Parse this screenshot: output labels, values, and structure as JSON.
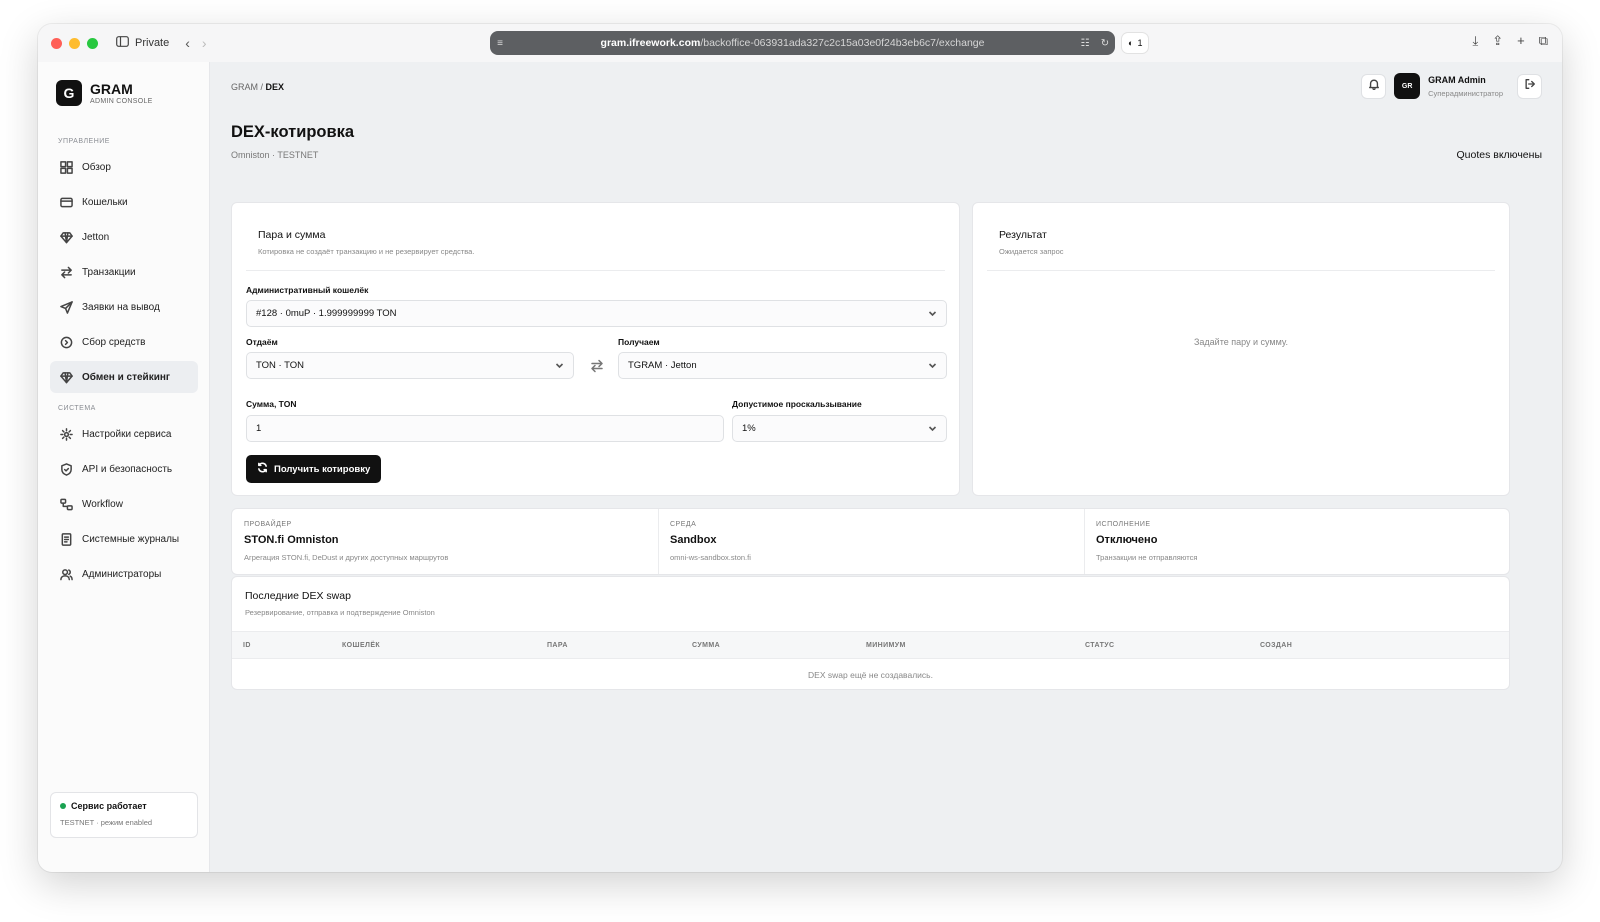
{
  "browser": {
    "private_label": "Private",
    "url_host": "gram.ifreework.com",
    "url_path": "/backoffice-063931ada327c2c15a03e0f24b3eb6c7/exchange",
    "badge_count": "1"
  },
  "brand": {
    "mark": "G",
    "title": "GRAM",
    "subtitle": "ADMIN CONSOLE"
  },
  "sidebar": {
    "section_manage": "УПРАВЛЕНИЕ",
    "section_system": "СИСТЕМА",
    "items": [
      {
        "label": "Обзор",
        "icon": "grid-icon"
      },
      {
        "label": "Кошельки",
        "icon": "wallet-icon"
      },
      {
        "label": "Jetton",
        "icon": "diamond-icon"
      },
      {
        "label": "Транзакции",
        "icon": "arrows-icon"
      },
      {
        "label": "Заявки на вывод",
        "icon": "send-icon"
      },
      {
        "label": "Сбор средств",
        "icon": "circle-icon"
      },
      {
        "label": "Обмен и стейкинг",
        "icon": "diamond-icon"
      }
    ],
    "system_items": [
      {
        "label": "Настройки сервиса",
        "icon": "gear-icon"
      },
      {
        "label": "API и безопасность",
        "icon": "shield-icon"
      },
      {
        "label": "Workflow",
        "icon": "workflow-icon"
      },
      {
        "label": "Системные журналы",
        "icon": "log-icon"
      },
      {
        "label": "Администраторы",
        "icon": "users-icon"
      }
    ],
    "status": {
      "title": "Сервис работает",
      "subtitle": "TESTNET · режим enabled",
      "color": "#1aa251"
    }
  },
  "header": {
    "breadcrumb_root": "GRAM",
    "breadcrumb_sep": " / ",
    "breadcrumb_current": "DEX",
    "avatar": "GR",
    "admin_name": "GRAM Admin",
    "admin_role": "Суперадминистратор"
  },
  "page": {
    "title": "DEX-котировка",
    "subtitle": "Omniston · TESTNET",
    "quotes_status": "Quotes включены"
  },
  "form": {
    "title": "Пара и сумма",
    "desc": "Котировка не создаёт транзакцию и не резервирует средства.",
    "wallet_label": "Административный кошелёк",
    "wallet_value": "#128 · 0muP · 1.999999999 TON",
    "give_label": "Отдаём",
    "give_value": "TON · TON",
    "get_label": "Получаем",
    "get_value": "TGRAM · Jetton",
    "amount_label": "Сумма, TON",
    "amount_value": "1",
    "slippage_label": "Допустимое проскальзывание",
    "slippage_value": "1%",
    "submit_label": "Получить котировку"
  },
  "result": {
    "title": "Результат",
    "desc": "Ожидается запрос",
    "empty": "Задайте пару и сумму."
  },
  "stats": [
    {
      "label": "ПРОВАЙДЕР",
      "value": "STON.fi Omniston",
      "desc": "Агрегация STON.fi, DeDust и других доступных маршрутов"
    },
    {
      "label": "СРЕДА",
      "value": "Sandbox",
      "desc": "omni-ws-sandbox.ston.fi"
    },
    {
      "label": "ИСПОЛНЕНИЕ",
      "value": "Отключено",
      "desc": "Транзакции не отправляются"
    }
  ],
  "swaps": {
    "title": "Последние DEX swap",
    "desc": "Резервирование, отправка и подтверждение Omniston",
    "columns": [
      "ID",
      "КОШЕЛЁК",
      "ПАРА",
      "СУММА",
      "МИНИМУМ",
      "СТАТУС",
      "СОЗДАН"
    ],
    "empty": "DEX swap ещё не создавались."
  }
}
